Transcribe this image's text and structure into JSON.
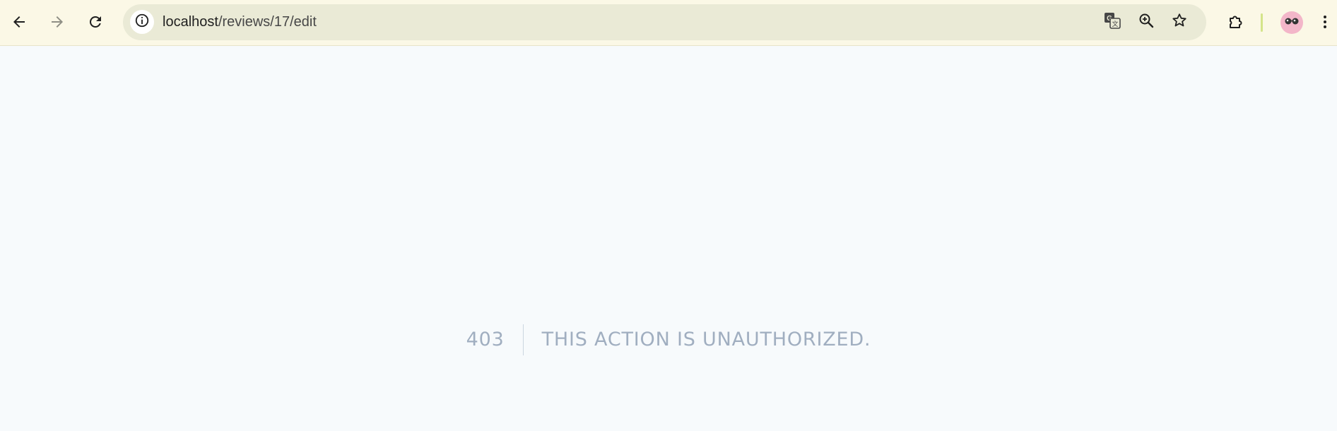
{
  "browser": {
    "url_host": "localhost",
    "url_path": "/reviews/17/edit",
    "icons": {
      "back": "arrow-left-icon",
      "forward": "arrow-right-icon",
      "reload": "reload-icon",
      "site_info": "info-icon",
      "translate": "translate-icon",
      "zoom": "zoom-in-icon",
      "bookmark": "star-icon",
      "extensions": "puzzle-icon",
      "profile": "avatar-icon",
      "menu": "kebab-menu-icon"
    },
    "colors": {
      "toolbar_bg": "#fbf8e6",
      "omnibox_bg": "#eaead6"
    }
  },
  "error": {
    "code": "403",
    "message": "THIS ACTION IS UNAUTHORIZED.",
    "text_color": "#a0aec0",
    "page_bg": "#f7fafc"
  }
}
